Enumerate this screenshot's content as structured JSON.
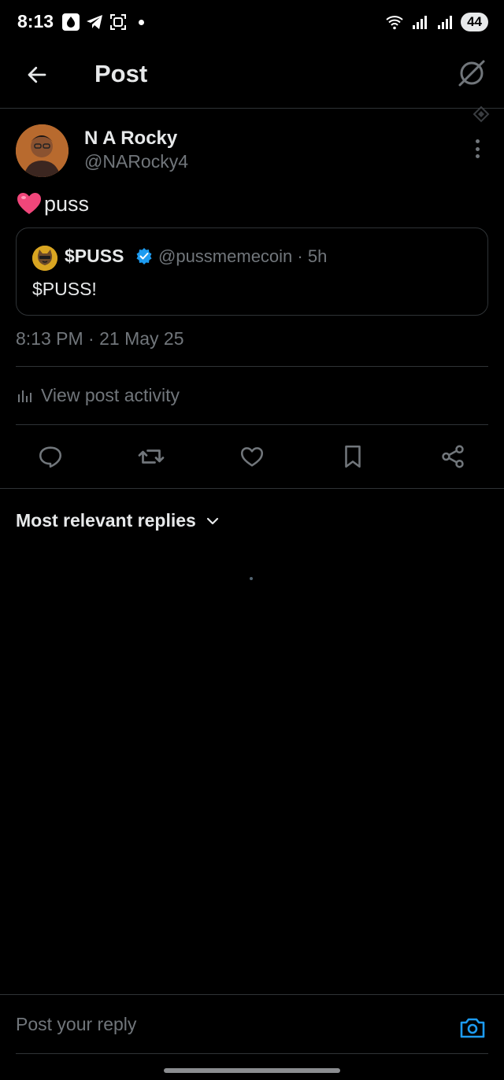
{
  "status_bar": {
    "time": "8:13",
    "battery": "44",
    "icons": [
      "drop-icon",
      "telegram-icon",
      "screenshot-icon",
      "notification-dot",
      "wifi-icon",
      "signal-icon",
      "signal-icon"
    ]
  },
  "header": {
    "title": "Post",
    "back_icon": "arrow-left-icon",
    "grok_icon": "grok-icon"
  },
  "post": {
    "author_name": "N A Rocky",
    "author_handle": "@NARocky4",
    "text": "puss",
    "emoji": "heart",
    "timestamp": "8:13 PM · 21 May 25",
    "view_activity": "View post activity"
  },
  "quote": {
    "name": "$PUSS",
    "verified": true,
    "handle_time": "@pussmemecoin · 5h",
    "text": "$PUSS!"
  },
  "actions": [
    "reply-icon",
    "repost-icon",
    "like-icon",
    "bookmark-icon",
    "share-icon"
  ],
  "replies": {
    "sort_label": "Most relevant replies"
  },
  "reply_bar": {
    "placeholder": "Post your reply"
  },
  "colors": {
    "background": "#000000",
    "text_primary": "#e7e9ea",
    "text_secondary": "#71767b",
    "border": "#2f3336",
    "accent": "#1d9bf0"
  }
}
